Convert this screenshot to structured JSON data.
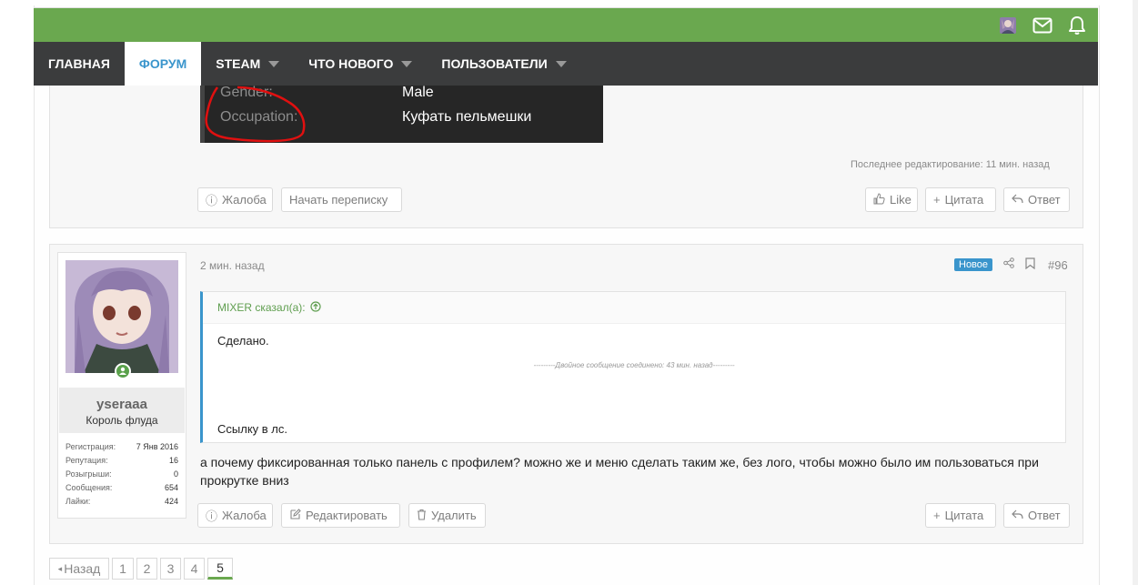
{
  "nav": {
    "items": [
      {
        "label": "ГЛАВНАЯ",
        "active": false,
        "dropdown": false
      },
      {
        "label": "ФОРУМ",
        "active": true,
        "dropdown": false
      },
      {
        "label": "STEAM",
        "active": false,
        "dropdown": true
      },
      {
        "label": "ЧТО НОВОГО",
        "active": false,
        "dropdown": true
      },
      {
        "label": "ПОЛЬЗОВАТЕЛИ",
        "active": false,
        "dropdown": true
      }
    ]
  },
  "topbar": {
    "icons": [
      "avatar-icon",
      "mail-icon",
      "bell-icon"
    ],
    "color": "#6aa84f"
  },
  "post1": {
    "profile_rows": [
      {
        "label": "Gender:",
        "value": "Male"
      },
      {
        "label": "Occupation:",
        "value": "Куфать пельмешки"
      }
    ],
    "edited": "Последнее редактирование: 11 мин. назад",
    "buttons": {
      "report": "Жалоба",
      "start_conversation": "Начать переписку",
      "like": "Like",
      "quote": "Цитата",
      "reply": "Ответ"
    }
  },
  "post2": {
    "time": "2 мин. назад",
    "badge": "Новое",
    "number": "#96",
    "user": {
      "name": "yseraaa",
      "title": "Король флуда",
      "stats": [
        {
          "label": "Регистрация:",
          "value": "7 Янв 2016"
        },
        {
          "label": "Репутация:",
          "value": "16"
        },
        {
          "label": "Розыгрыши:",
          "value": "0"
        },
        {
          "label": "Сообщения:",
          "value": "654"
        },
        {
          "label": "Лайки:",
          "value": "424"
        }
      ]
    },
    "quote": {
      "author": "MIXER сказал(а):",
      "line1": "Сделано.",
      "merged": "---------Двойное сообщение соединено: 43 мин. назад---------",
      "line2": "Ссылку в лс."
    },
    "text": "а почему фиксированная только панель с профилем? можно же и меню сделать таким же, без лого, чтобы можно было им пользоваться при прокрутке вниз",
    "buttons": {
      "report": "Жалоба",
      "edit": "Редактировать",
      "delete": "Удалить",
      "quote": "Цитата",
      "reply": "Ответ"
    }
  },
  "pager": {
    "prev": "Назад",
    "pages": [
      "1",
      "2",
      "3",
      "4",
      "5"
    ],
    "current": "5"
  },
  "colors": {
    "accent": "#3a95cc",
    "brand_green": "#6aa84f",
    "nav_bg": "#3b3c3d"
  }
}
